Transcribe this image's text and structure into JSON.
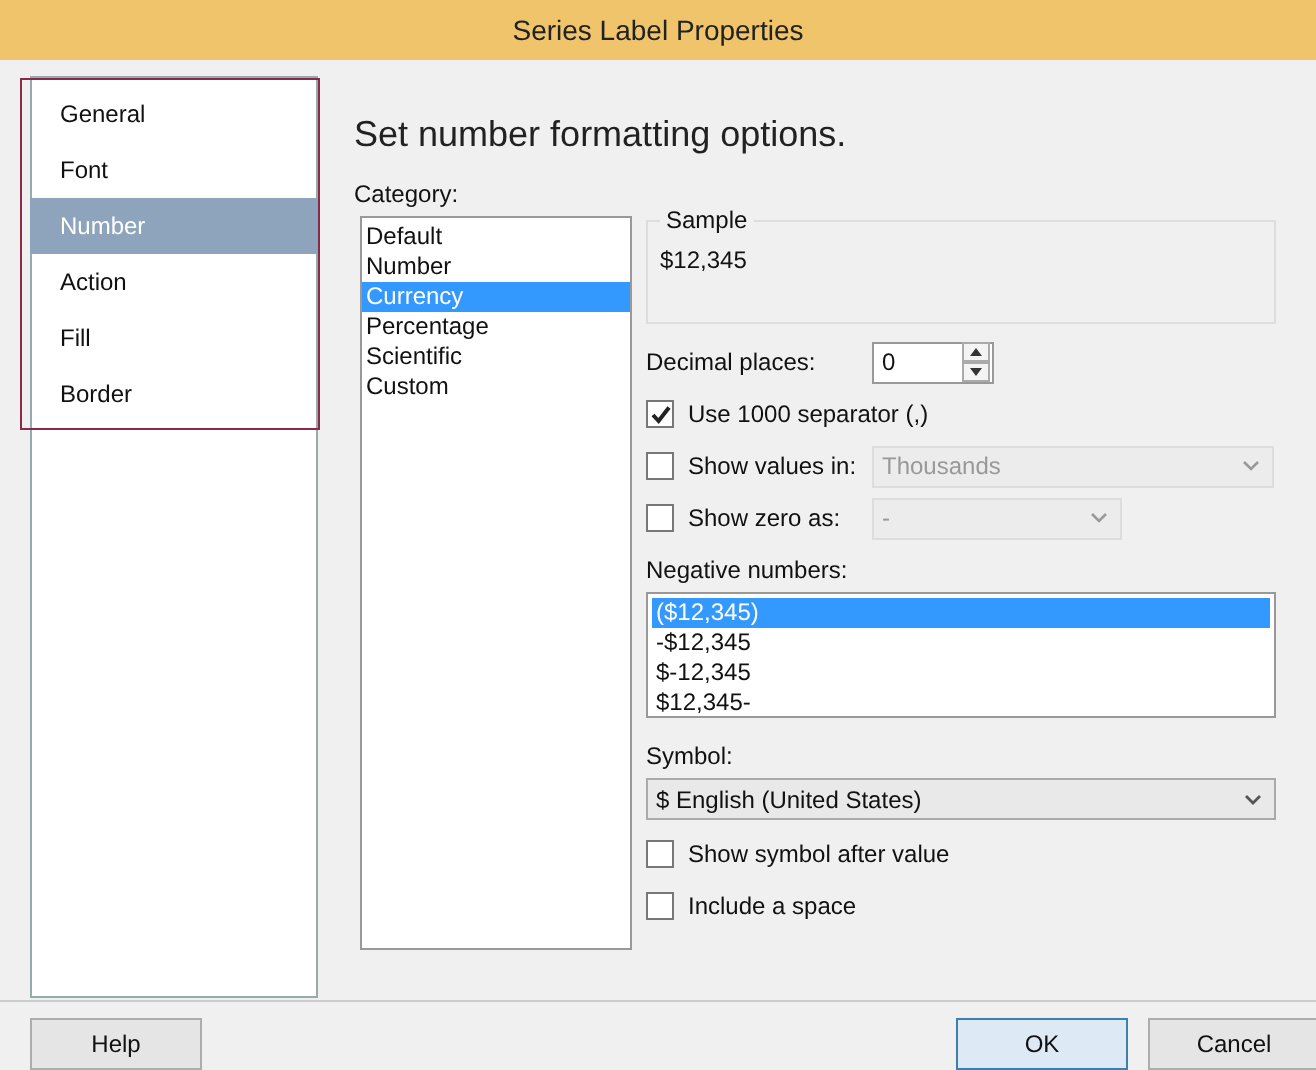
{
  "window": {
    "title": "Series Label Properties"
  },
  "sidebar": {
    "items": [
      {
        "label": "General",
        "selected": false
      },
      {
        "label": "Font",
        "selected": false
      },
      {
        "label": "Number",
        "selected": true
      },
      {
        "label": "Action",
        "selected": false
      },
      {
        "label": "Fill",
        "selected": false
      },
      {
        "label": "Border",
        "selected": false
      }
    ]
  },
  "heading": "Set number formatting options.",
  "category": {
    "label": "Category:",
    "items": [
      {
        "label": "Default",
        "selected": false
      },
      {
        "label": "Number",
        "selected": false
      },
      {
        "label": "Currency",
        "selected": true
      },
      {
        "label": "Percentage",
        "selected": false
      },
      {
        "label": "Scientific",
        "selected": false
      },
      {
        "label": "Custom",
        "selected": false
      }
    ]
  },
  "sample": {
    "label": "Sample",
    "value": "$12,345"
  },
  "decimal_places": {
    "label": "Decimal places:",
    "value": "0"
  },
  "use_separator": {
    "label": "Use 1000 separator (,)",
    "checked": true
  },
  "show_values_in": {
    "label": "Show values in:",
    "checked": false,
    "value": "Thousands",
    "disabled": true
  },
  "show_zero_as": {
    "label": "Show zero as:",
    "checked": false,
    "value": "-",
    "disabled": true
  },
  "negative_numbers": {
    "label": "Negative numbers:",
    "items": [
      {
        "label": "($12,345)",
        "selected": true
      },
      {
        "label": "-$12,345",
        "selected": false
      },
      {
        "label": "$-12,345",
        "selected": false
      },
      {
        "label": "$12,345-",
        "selected": false
      }
    ]
  },
  "symbol": {
    "label": "Symbol:",
    "value": "$ English (United States)"
  },
  "symbol_after": {
    "label": "Show symbol after value",
    "checked": false
  },
  "include_space": {
    "label": "Include a space",
    "checked": false
  },
  "buttons": {
    "help": "Help",
    "ok": "OK",
    "cancel": "Cancel"
  }
}
